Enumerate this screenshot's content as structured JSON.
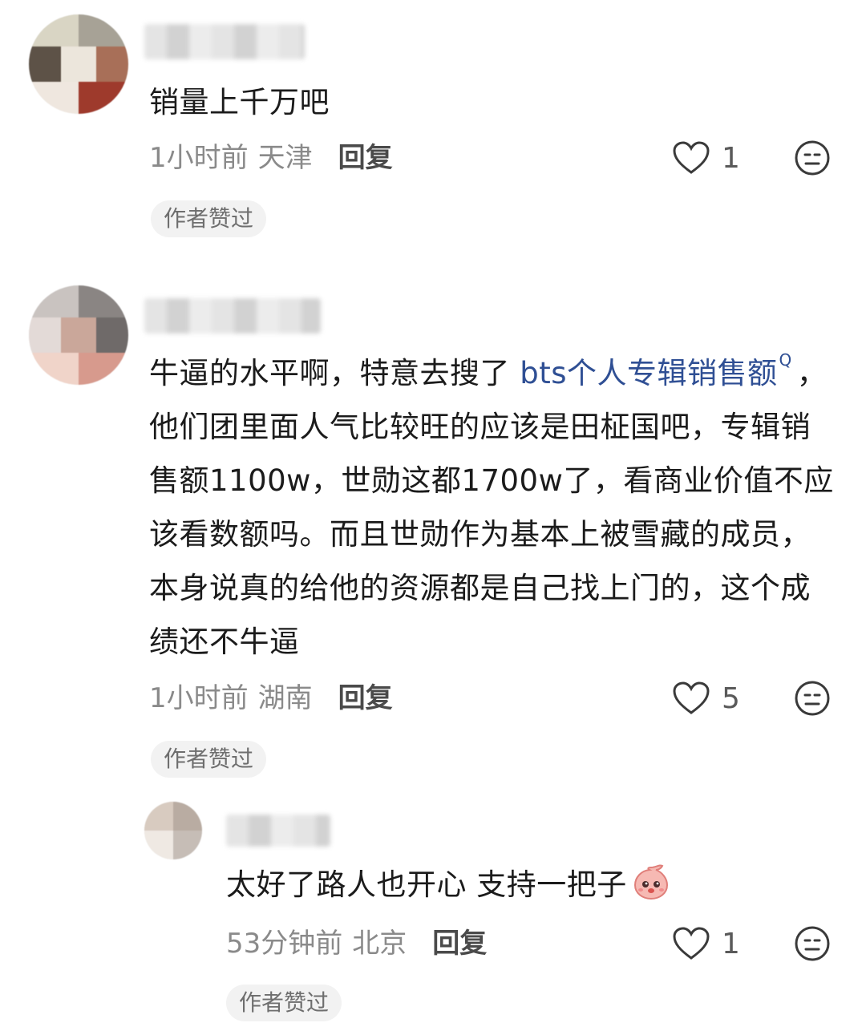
{
  "comments": [
    {
      "text": "销量上千万吧",
      "time": "1小时前",
      "location": "天津",
      "reply_label": "回复",
      "likes": "1",
      "badge": "作者赞过"
    },
    {
      "text_before": "牛逼的水平啊，特意去搜了 ",
      "search_link": "bts个人专辑销售额",
      "search_glyph": "Q",
      "text_after": "，他们团里面人气比较旺的应该是田柾国吧，专辑销售额1100w，世勋这都1700w了，看商业价值不应该看数额吗。而且世勋作为基本上被雪藏的成员，本身说真的给他的资源都是自己找上门的，这个成绩还不牛逼",
      "time": "1小时前",
      "location": "湖南",
      "reply_label": "回复",
      "likes": "5",
      "badge": "作者赞过"
    }
  ],
  "reply": {
    "text": "太好了路人也开心 支持一把子",
    "emoji": "peach-face-emoji",
    "time": "53分钟前",
    "location": "北京",
    "reply_label": "回复",
    "likes": "1",
    "badge": "作者赞过"
  },
  "colors": {
    "link": "#2f4f94",
    "meta": "#8a8a8a",
    "pill_bg": "#f2f2f2"
  }
}
